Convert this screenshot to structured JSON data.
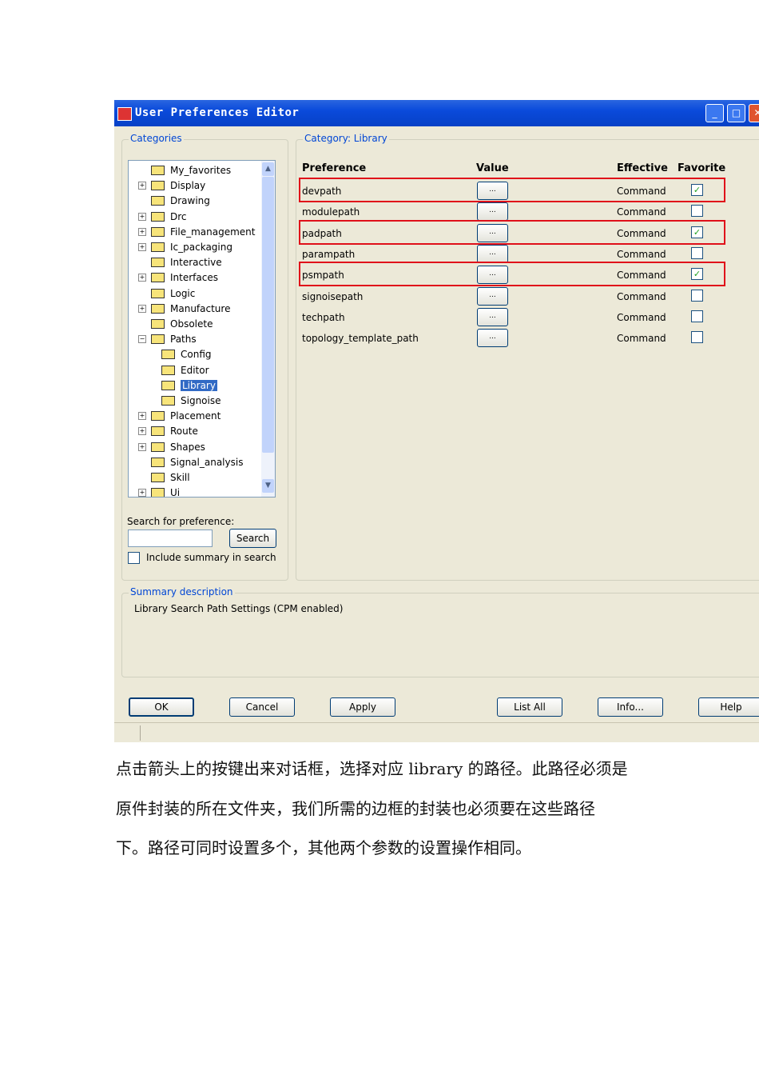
{
  "window": {
    "title": "User Preferences Editor",
    "minimize": "_",
    "maximize": "□",
    "close": "✕"
  },
  "categories": {
    "legend": "Categories",
    "tree": [
      {
        "label": "My_favorites",
        "level": 0,
        "exp": false
      },
      {
        "label": "Display",
        "level": 0,
        "exp": true
      },
      {
        "label": "Drawing",
        "level": 0,
        "exp": false
      },
      {
        "label": "Drc",
        "level": 0,
        "exp": true
      },
      {
        "label": "File_management",
        "level": 0,
        "exp": true
      },
      {
        "label": "Ic_packaging",
        "level": 0,
        "exp": true
      },
      {
        "label": "Interactive",
        "level": 0,
        "exp": false
      },
      {
        "label": "Interfaces",
        "level": 0,
        "exp": true
      },
      {
        "label": "Logic",
        "level": 0,
        "exp": false
      },
      {
        "label": "Manufacture",
        "level": 0,
        "exp": true
      },
      {
        "label": "Obsolete",
        "level": 0,
        "exp": false
      },
      {
        "label": "Paths",
        "level": 0,
        "exp": "open"
      },
      {
        "label": "Config",
        "level": 1,
        "exp": false
      },
      {
        "label": "Editor",
        "level": 1,
        "exp": false
      },
      {
        "label": "Library",
        "level": 1,
        "exp": false,
        "selected": true
      },
      {
        "label": "Signoise",
        "level": 1,
        "exp": false
      },
      {
        "label": "Placement",
        "level": 0,
        "exp": true
      },
      {
        "label": "Route",
        "level": 0,
        "exp": true
      },
      {
        "label": "Shapes",
        "level": 0,
        "exp": true
      },
      {
        "label": "Signal_analysis",
        "level": 0,
        "exp": false
      },
      {
        "label": "Skill",
        "level": 0,
        "exp": false
      },
      {
        "label": "Ui",
        "level": 0,
        "exp": true
      }
    ],
    "search_label": "Search for preference:",
    "search_value": "",
    "search_button": "Search",
    "include_summary": "Include summary in search"
  },
  "category": {
    "legend": "Category:  Library",
    "headers": {
      "preference": "Preference",
      "value": "Value",
      "effective": "Effective",
      "favorite": "Favorite"
    },
    "rows": [
      {
        "preference": "devpath",
        "value": "...",
        "effective": "Command",
        "favorite": true,
        "highlighted": true
      },
      {
        "preference": "modulepath",
        "value": "...",
        "effective": "Command",
        "favorite": false
      },
      {
        "preference": "padpath",
        "value": "...",
        "effective": "Command",
        "favorite": true,
        "highlighted": true
      },
      {
        "preference": "parampath",
        "value": "...",
        "effective": "Command",
        "favorite": false
      },
      {
        "preference": "psmpath",
        "value": "...",
        "effective": "Command",
        "favorite": true,
        "highlighted": true
      },
      {
        "preference": "signoisepath",
        "value": "...",
        "effective": "Command",
        "favorite": false
      },
      {
        "preference": "techpath",
        "value": "...",
        "effective": "Command",
        "favorite": false
      },
      {
        "preference": "topology_template_path",
        "value": "...",
        "effective": "Command",
        "favorite": false
      }
    ]
  },
  "summary": {
    "legend": "Summary description",
    "text": "Library Search Path Settings (CPM enabled)"
  },
  "buttons": {
    "ok": "OK",
    "cancel": "Cancel",
    "apply": "Apply",
    "list_all": "List All",
    "info": "Info...",
    "help": "Help"
  },
  "caption": [
    "点击箭头上的按键出来对话框，选择对应 library 的路径。此路径必须是",
    "原件封装的所在文件夹，我们所需的边框的封装也必须要在这些路径",
    "下。路径可同时设置多个，其他两个参数的设置操作相同。"
  ]
}
